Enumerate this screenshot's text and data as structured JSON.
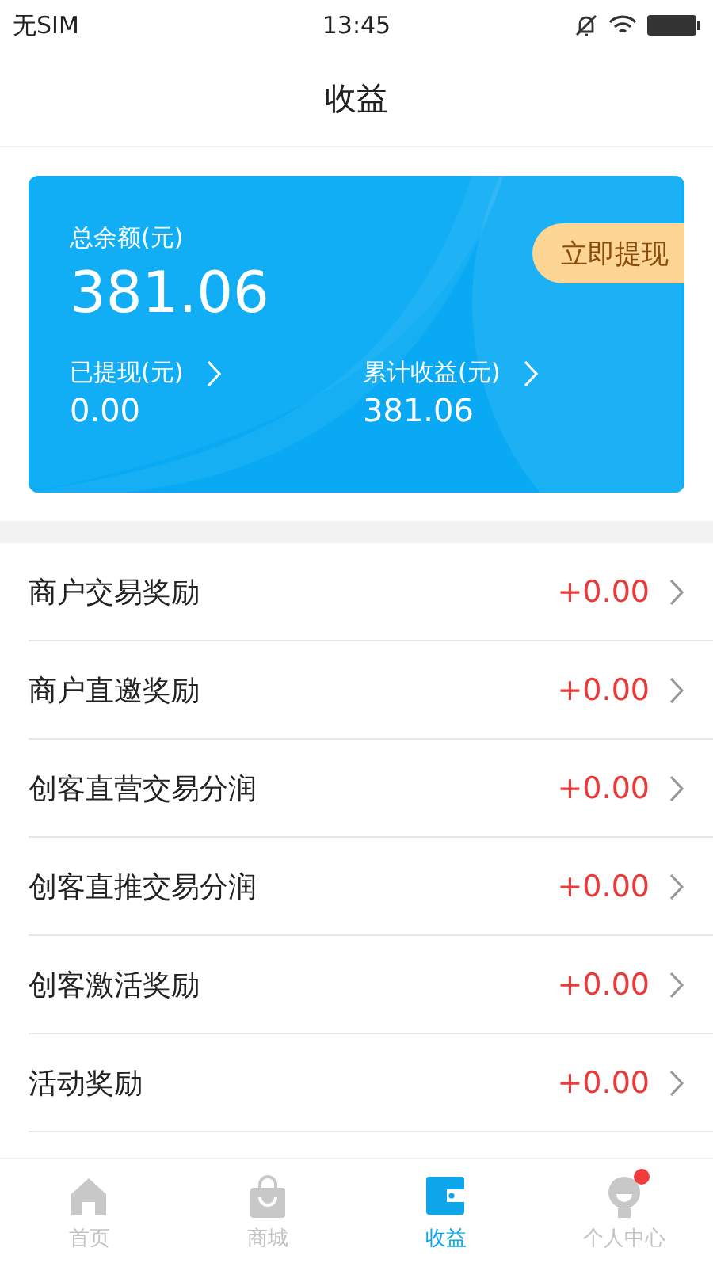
{
  "status_bar": {
    "carrier": "无SIM",
    "time": "13:45"
  },
  "title": "收益",
  "balance_card": {
    "label": "总余额(元)",
    "amount": "381.06",
    "withdraw_button": "立即提现",
    "stats": [
      {
        "label": "已提现(元)",
        "value": "0.00"
      },
      {
        "label": "累计收益(元)",
        "value": "381.06"
      }
    ]
  },
  "income_items": [
    {
      "label": "商户交易奖励",
      "amount": "+0.00"
    },
    {
      "label": "商户直邀奖励",
      "amount": "+0.00"
    },
    {
      "label": "创客直营交易分润",
      "amount": "+0.00"
    },
    {
      "label": "创客直推交易分润",
      "amount": "+0.00"
    },
    {
      "label": "创客激活奖励",
      "amount": "+0.00"
    },
    {
      "label": "活动奖励",
      "amount": "+0.00"
    }
  ],
  "tabs": [
    {
      "kind": "home",
      "label": "首页",
      "selected": false,
      "badge": false
    },
    {
      "kind": "shop",
      "label": "商城",
      "selected": false,
      "badge": false
    },
    {
      "kind": "wallet",
      "label": "收益",
      "selected": true,
      "badge": false
    },
    {
      "kind": "profile",
      "label": "个人中心",
      "selected": false,
      "badge": true
    }
  ]
}
